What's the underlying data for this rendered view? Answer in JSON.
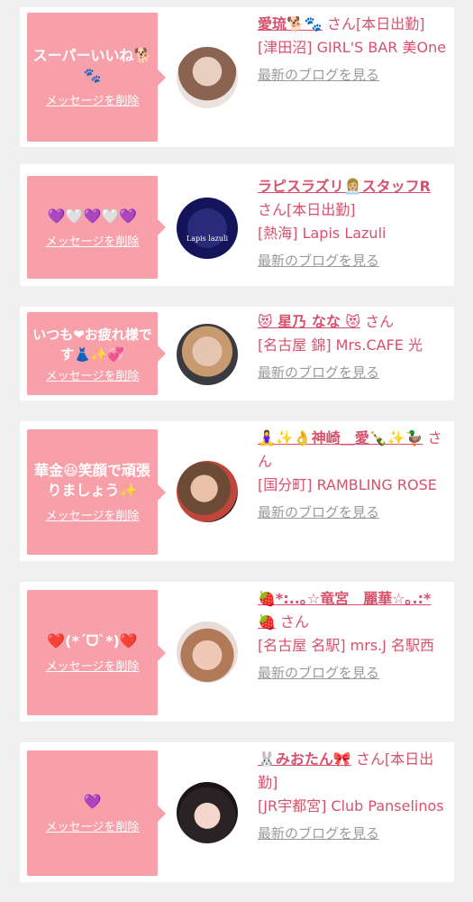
{
  "cards": [
    {
      "message": "スーパーいいね🐕🐾",
      "delete_label": "メッセージを削除",
      "name": "愛琉🐕🐾",
      "san_status": "さん[本日出勤]",
      "shop": "[津田沼] GIRL'S BAR 美One",
      "blog_label": "最新のブログを見る"
    },
    {
      "message": "💜🤍💜🤍💜",
      "delete_label": "メッセージを削除",
      "name": "ラピスラズリ👩🏼‍💼スタッフR",
      "san_status": "さん[本日出勤]",
      "shop": "[熱海] Lapis Lazuli",
      "blog_label": "最新のブログを見る",
      "avatar_text": "Lapis lazuli"
    },
    {
      "message": "いつも❤お疲れ様です👗✨💞",
      "delete_label": "メッセージを削除",
      "name": "😻 星乃 なな 😻",
      "san_status": "さん",
      "shop": "[名古屋 錦] Mrs.CAFE 光",
      "blog_label": "最新のブログを見る"
    },
    {
      "message": "華金😆笑顔で頑張りましょう✨",
      "delete_label": "メッセージを削除",
      "name": "🧘‍♀️✨👌神崎＿愛🍾✨🦆",
      "san_status": "さん",
      "shop": "[国分町] RAMBLING ROSE",
      "blog_label": "最新のブログを見る"
    },
    {
      "message": "❤️(*´ᗜ`*)❤️",
      "delete_label": "メッセージを削除",
      "name": "🍓*:..｡☆竜宮　麗華☆｡.:*🍓",
      "san_status": "さん",
      "shop": "[名古屋 名駅] mrs.J 名駅西",
      "blog_label": "最新のブログを見る"
    },
    {
      "message": "💜",
      "delete_label": "メッセージを削除",
      "name": "🐰みおたん🎀",
      "san_status": "さん[本日出勤]",
      "shop": "[JR宇都宮] Club Panselinos",
      "blog_label": "最新のブログを見る"
    }
  ]
}
